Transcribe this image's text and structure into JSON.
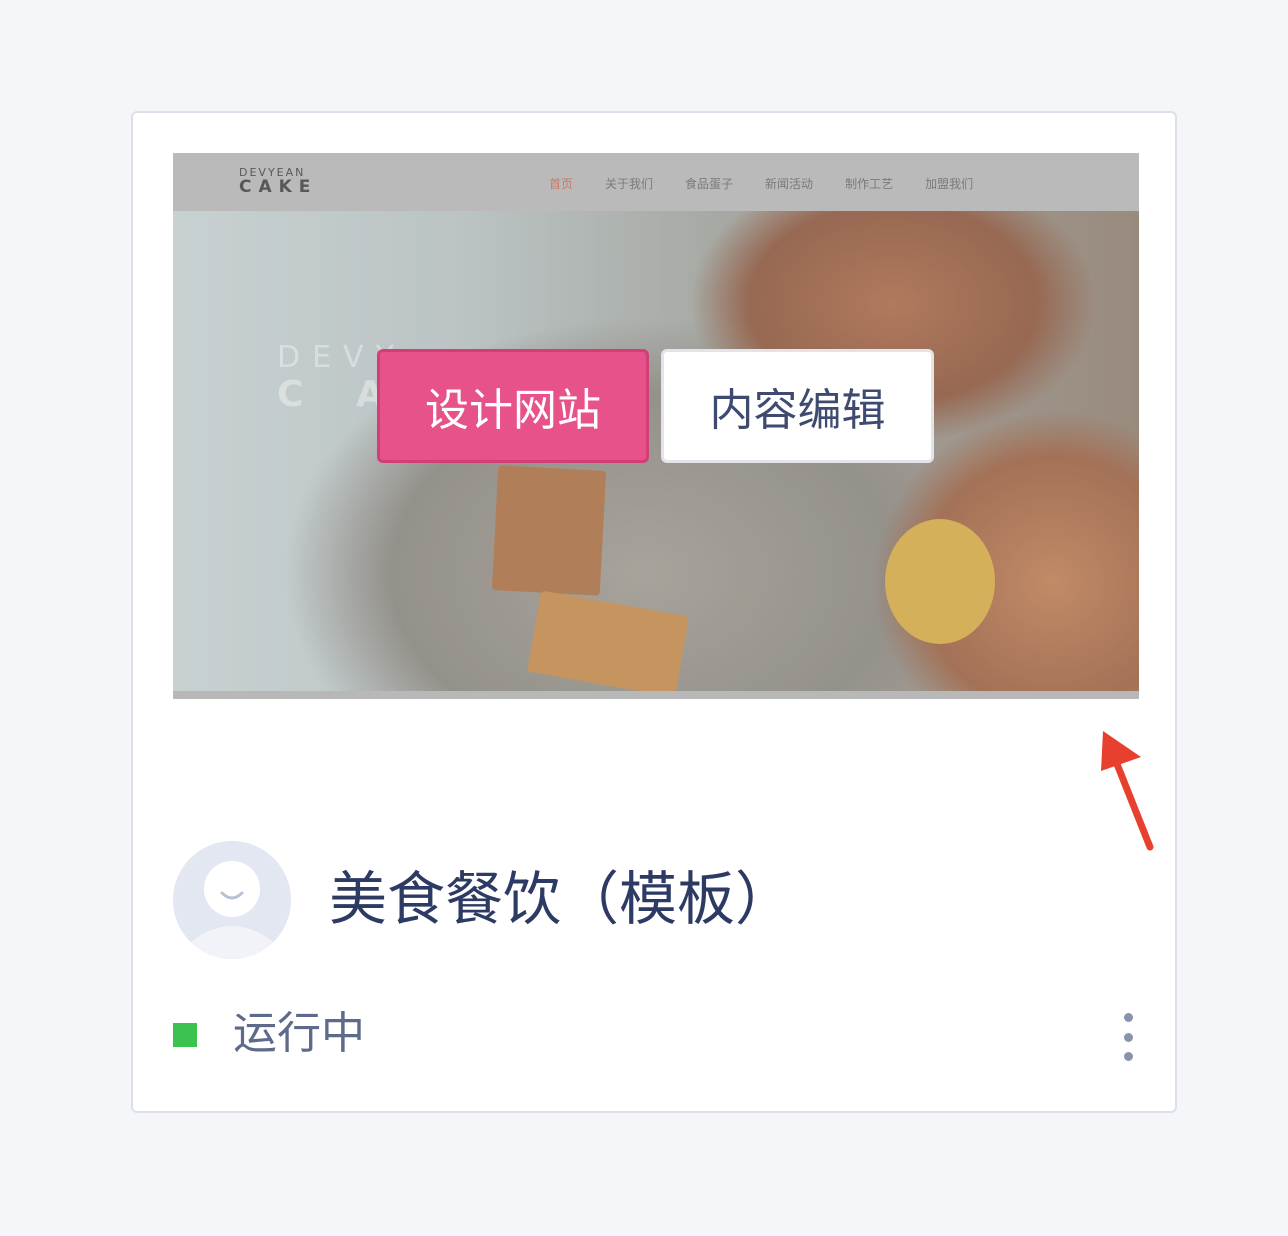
{
  "preview": {
    "logo_top": "DEVYEAN",
    "logo_main": "CAKE",
    "nav": [
      "首页",
      "关于我们",
      "食品蛋子",
      "新闻活动",
      "制作工艺",
      "加盟我们"
    ],
    "ghost_line1": "DEVY",
    "ghost_line2": "C A"
  },
  "actions": {
    "design_label": "设计网站",
    "edit_label": "内容编辑"
  },
  "site": {
    "title": "美食餐饮（模板）",
    "status": "运行中"
  },
  "colors": {
    "primary": "#e8528a",
    "title": "#2d3a63",
    "status_running": "#3cc24f",
    "annotation_arrow": "#e8402e"
  }
}
